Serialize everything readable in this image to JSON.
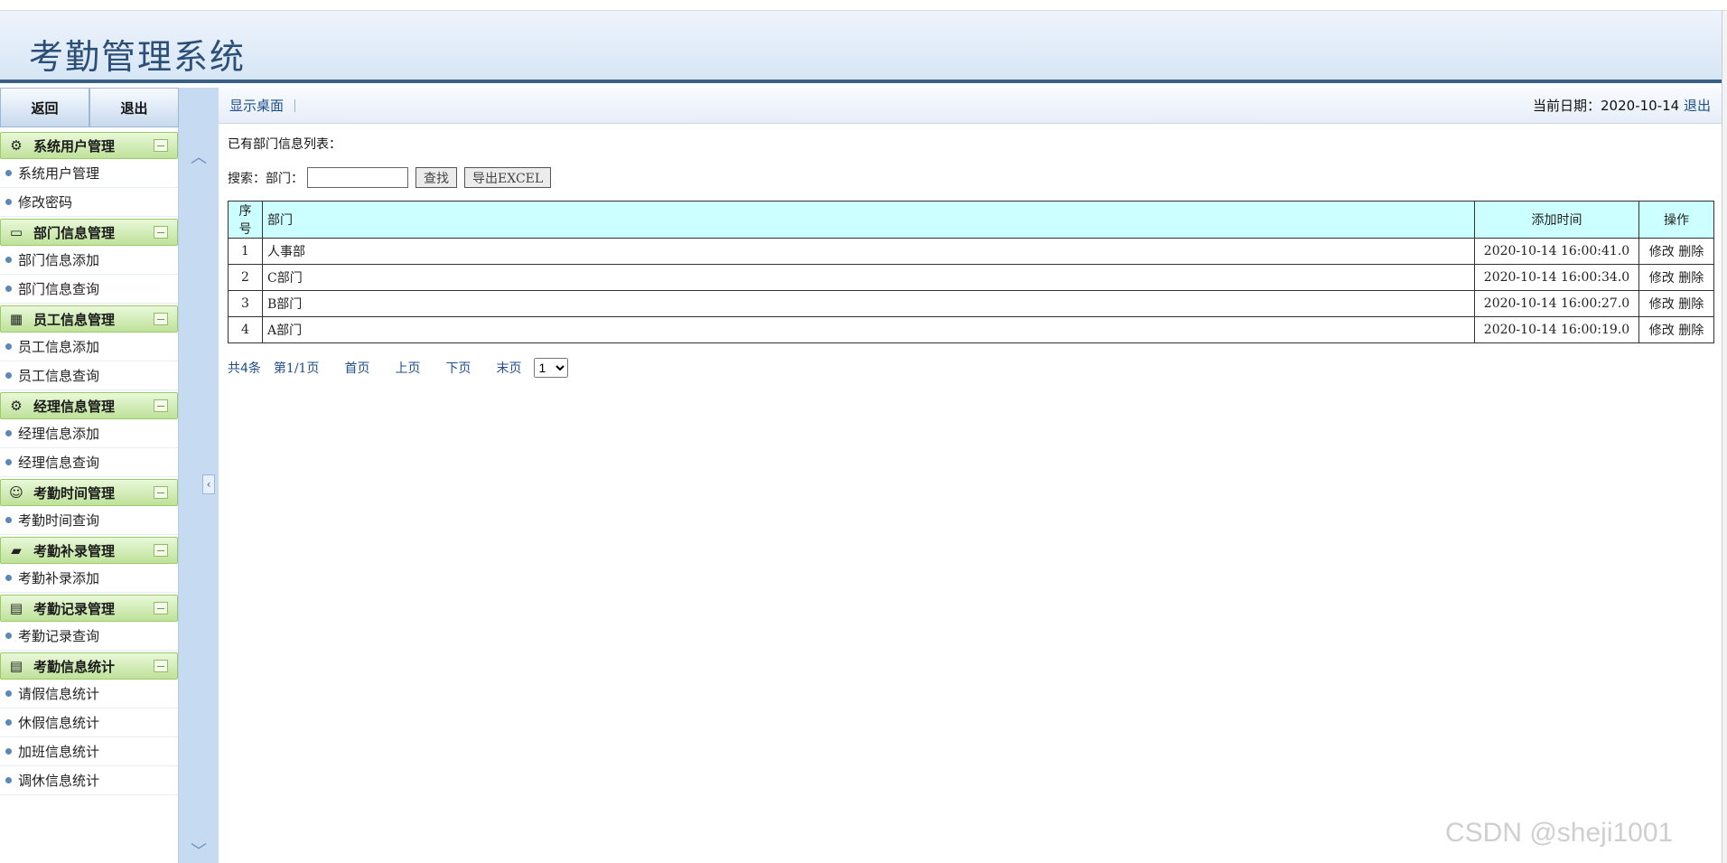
{
  "app": {
    "title": "考勤管理系统"
  },
  "topbuttons": {
    "back": "返回",
    "logout": "退出"
  },
  "menu": [
    {
      "title": "系统用户管理",
      "icon": "gear-icon",
      "items": [
        "系统用户管理",
        "修改密码"
      ]
    },
    {
      "title": "部门信息管理",
      "icon": "monitor-icon",
      "items": [
        "部门信息添加",
        "部门信息查询"
      ]
    },
    {
      "title": "员工信息管理",
      "icon": "calendar-icon",
      "items": [
        "员工信息添加",
        "员工信息查询"
      ]
    },
    {
      "title": "经理信息管理",
      "icon": "gear-icon",
      "items": [
        "经理信息添加",
        "经理信息查询"
      ]
    },
    {
      "title": "考勤时间管理",
      "icon": "user-icon",
      "items": [
        "考勤时间查询"
      ]
    },
    {
      "title": "考勤补录管理",
      "icon": "folder-icon",
      "items": [
        "考勤补录添加"
      ]
    },
    {
      "title": "考勤记录管理",
      "icon": "clipboard-icon",
      "items": [
        "考勤记录查询"
      ]
    },
    {
      "title": "考勤信息统计",
      "icon": "clipboard-icon",
      "items": [
        "请假信息统计",
        "休假信息统计",
        "加班信息统计",
        "调休信息统计"
      ]
    }
  ],
  "toolbar": {
    "desktop_link": "显示桌面",
    "date_label": "当前日期：2020-10-14",
    "logout_link": "退出"
  },
  "content": {
    "list_title": "已有部门信息列表：",
    "search_label": "搜索：部门：",
    "search_value": "",
    "find_button": "查找",
    "export_button": "导出EXCEL"
  },
  "table": {
    "headers": [
      "序号",
      "部门",
      "添加时间",
      "操作"
    ],
    "rows": [
      {
        "no": "1",
        "dept": "人事部",
        "time": "2020-10-14 16:00:41.0",
        "edit": "修改",
        "del": "删除"
      },
      {
        "no": "2",
        "dept": "C部门",
        "time": "2020-10-14 16:00:34.0",
        "edit": "修改",
        "del": "删除"
      },
      {
        "no": "3",
        "dept": "B部门",
        "time": "2020-10-14 16:00:27.0",
        "edit": "修改",
        "del": "删除"
      },
      {
        "no": "4",
        "dept": "A部门",
        "time": "2020-10-14 16:00:19.0",
        "edit": "修改",
        "del": "删除"
      }
    ]
  },
  "pager": {
    "total": "共4条",
    "page": "第1/1页",
    "first": "首页",
    "prev": "上页",
    "next": "下页",
    "last": "末页",
    "current": "1"
  },
  "watermark": "CSDN @sheji1001"
}
